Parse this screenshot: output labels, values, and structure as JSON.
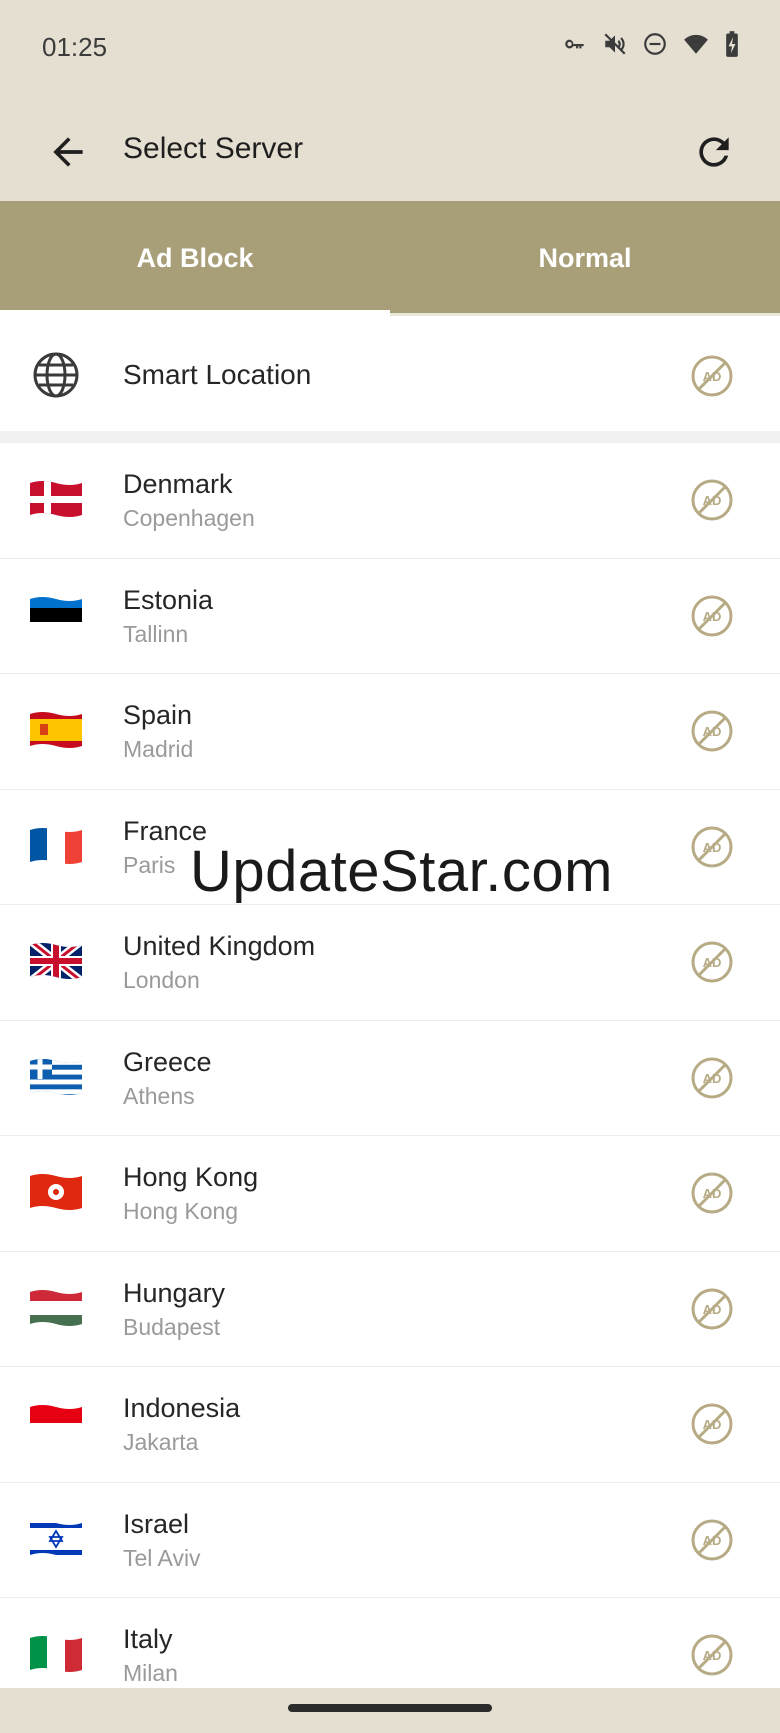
{
  "status": {
    "time": "01:25"
  },
  "header": {
    "title": "Select Server"
  },
  "tabs": [
    {
      "label": "Ad Block",
      "selected": true
    },
    {
      "label": "Normal",
      "selected": false
    }
  ],
  "smart": {
    "label": "Smart Location"
  },
  "ad_icon_text": "AD",
  "servers": [
    {
      "country": "Denmark",
      "city": "Copenhagen",
      "flag": "dk-flag-icon"
    },
    {
      "country": "Estonia",
      "city": "Tallinn",
      "flag": "ee-flag-icon"
    },
    {
      "country": "Spain",
      "city": "Madrid",
      "flag": "es-flag-icon"
    },
    {
      "country": "France",
      "city": "Paris",
      "flag": "fr-flag-icon"
    },
    {
      "country": "United Kingdom",
      "city": "London",
      "flag": "gb-flag-icon"
    },
    {
      "country": "Greece",
      "city": "Athens",
      "flag": "gr-flag-icon"
    },
    {
      "country": "Hong Kong",
      "city": "Hong Kong",
      "flag": "hk-flag-icon"
    },
    {
      "country": "Hungary",
      "city": "Budapest",
      "flag": "hu-flag-icon"
    },
    {
      "country": "Indonesia",
      "city": "Jakarta",
      "flag": "id-flag-icon"
    },
    {
      "country": "Israel",
      "city": "Tel Aviv",
      "flag": "il-flag-icon"
    },
    {
      "country": "Italy",
      "city": "Milan",
      "flag": "it-flag-icon"
    }
  ],
  "watermark": "UpdateStar.com",
  "colors": {
    "tab_bar": "#a89f78",
    "header_bg": "#e5dfd1",
    "ad_icon": "#b7ab86"
  }
}
